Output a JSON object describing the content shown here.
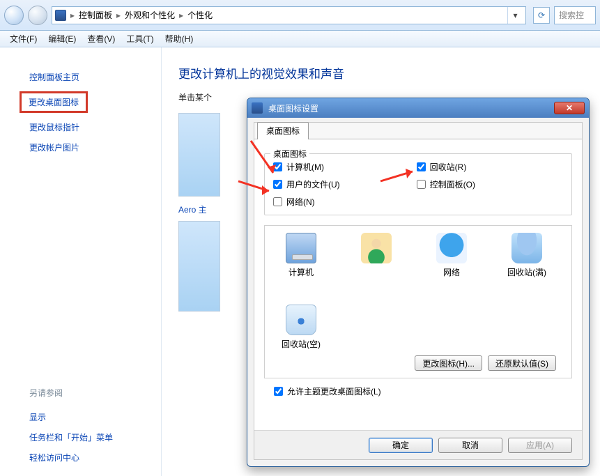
{
  "addressbar": {
    "crumbs": [
      "控制面板",
      "外观和个性化",
      "个性化"
    ],
    "search_placeholder": "搜索控"
  },
  "menubar": [
    "文件(F)",
    "编辑(E)",
    "查看(V)",
    "工具(T)",
    "帮助(H)"
  ],
  "sidebar": {
    "home": "控制面板主页",
    "links": [
      "更改桌面图标",
      "更改鼠标指针",
      "更改帐户图片"
    ],
    "see_also_label": "另请参阅",
    "see_also": [
      "显示",
      "任务栏和「开始」菜单",
      "轻松访问中心"
    ]
  },
  "content": {
    "title": "更改计算机上的视觉效果和声音",
    "subtitle_prefix": "单击某个",
    "aero_label": "Aero 主"
  },
  "dialog": {
    "title": "桌面图标设置",
    "tab": "桌面图标",
    "group_label": "桌面图标",
    "checks": {
      "computer": "计算机(M)",
      "userfiles": "用户的文件(U)",
      "network": "网络(N)",
      "recycle": "回收站(R)",
      "controlpanel": "控制面板(O)"
    },
    "icons": {
      "computer": "计算机",
      "network": "网络",
      "recycle_full": "回收站(满)",
      "recycle_empty": "回收站(空)"
    },
    "change_icon": "更改图标(H)...",
    "restore_default": "还原默认值(S)",
    "allow_themes": "允许主题更改桌面图标(L)",
    "ok": "确定",
    "cancel": "取消",
    "apply": "应用(A)"
  }
}
